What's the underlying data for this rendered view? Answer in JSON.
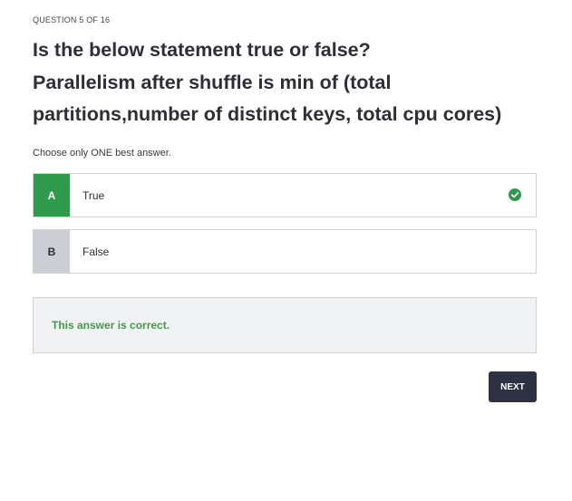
{
  "quiz": {
    "counter": "QUESTION 5 OF 16",
    "question_lines": [
      "Is the below statement true or false?",
      "Parallelism after shuffle is min of (total",
      "partitions,number of distinct keys, total cpu cores)"
    ],
    "instructions": "Choose only ONE best answer.",
    "options": [
      {
        "letter": "A",
        "label": "True",
        "state": "correct-selected"
      },
      {
        "letter": "B",
        "label": "False",
        "state": "unselected"
      }
    ],
    "feedback": "This answer is correct.",
    "next_label": "NEXT"
  },
  "icons": {
    "correct": "check-circle-icon"
  },
  "colors": {
    "correct_green": "#2f9a4c",
    "feedback_green": "#3f9a4a",
    "option_gray": "#ccced6",
    "button_dark": "#2e3142",
    "feedback_bg": "#f1f2f3"
  }
}
